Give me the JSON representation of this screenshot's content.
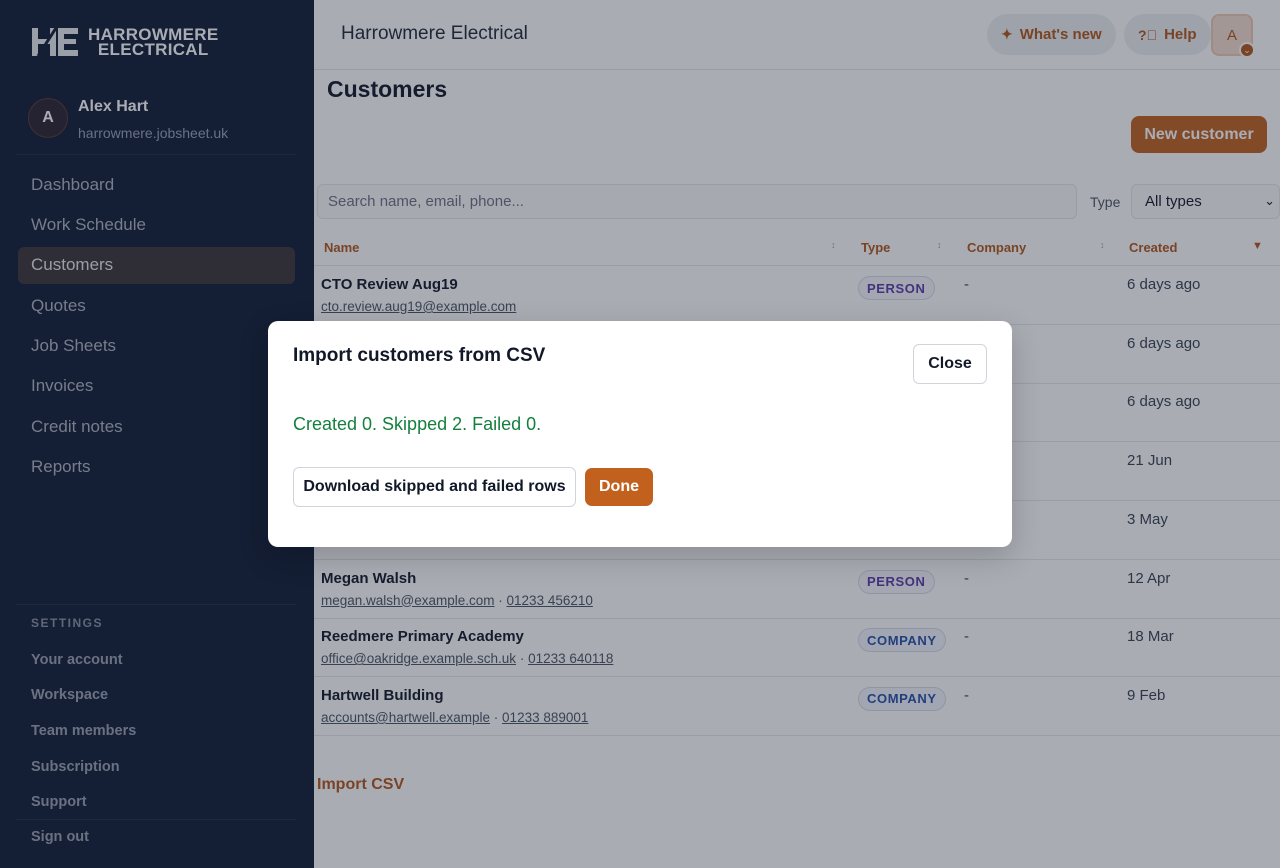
{
  "brand": {
    "logo_line1": "HARROWMERE",
    "logo_line2": "ELECTRICAL"
  },
  "user": {
    "initial": "A",
    "name": "Alex Hart",
    "domain": "harrowmere.jobsheet.uk"
  },
  "nav": [
    {
      "label": "Dashboard"
    },
    {
      "label": "Work Schedule"
    },
    {
      "label": "Customers",
      "active": true
    },
    {
      "label": "Quotes"
    },
    {
      "label": "Job Sheets"
    },
    {
      "label": "Invoices"
    },
    {
      "label": "Credit notes"
    },
    {
      "label": "Reports"
    }
  ],
  "settings": {
    "heading": "SETTINGS",
    "items": [
      {
        "label": "Your account"
      },
      {
        "label": "Workspace"
      },
      {
        "label": "Team members"
      },
      {
        "label": "Subscription"
      },
      {
        "label": "Support"
      }
    ],
    "sign_out": "Sign out"
  },
  "topbar": {
    "title": "Harrowmere Electrical",
    "whats_new": "What's new",
    "help": "Help",
    "avatar_initial": "A"
  },
  "page": {
    "title": "Customers",
    "new_button": "New customer",
    "search_placeholder": "Search name, email, phone...",
    "type_label": "Type",
    "type_value": "All types",
    "import_link": "Import CSV"
  },
  "table": {
    "columns": {
      "name": "Name",
      "type": "Type",
      "company": "Company",
      "created": "Created"
    },
    "rows": [
      {
        "name": "CTO Review Aug19",
        "email": "cto.review.aug19@example.com",
        "phone": "",
        "type": "PERSON",
        "company": "-",
        "created": "6 days ago"
      },
      {
        "name": "",
        "email": "",
        "phone": "",
        "type": "",
        "company": "",
        "created": "6 days ago"
      },
      {
        "name": "",
        "email": "",
        "phone": "",
        "type": "",
        "company": "",
        "created": "6 days ago"
      },
      {
        "name": "",
        "email": "",
        "phone": "",
        "type": "",
        "company": "",
        "created": "21 Jun"
      },
      {
        "name": "",
        "email": "",
        "phone": "",
        "type": "",
        "company": "",
        "created": "3 May"
      },
      {
        "name": "Megan Walsh",
        "email": "megan.walsh@example.com",
        "phone": "01233 456210",
        "type": "PERSON",
        "company": "-",
        "created": "12 Apr"
      },
      {
        "name": "Reedmere Primary Academy",
        "email": "office@oakridge.example.sch.uk",
        "phone": "01233 640118",
        "type": "COMPANY",
        "company": "-",
        "created": "18 Mar"
      },
      {
        "name": "Hartwell Building",
        "email": "accounts@hartwell.example",
        "phone": "01233 889001",
        "type": "COMPANY",
        "company": "-",
        "created": "9 Feb"
      }
    ]
  },
  "modal": {
    "title": "Import customers from CSV",
    "close": "Close",
    "result": "Created 0. Skipped 2. Failed 0.",
    "download": "Download skipped and failed rows",
    "done": "Done"
  }
}
